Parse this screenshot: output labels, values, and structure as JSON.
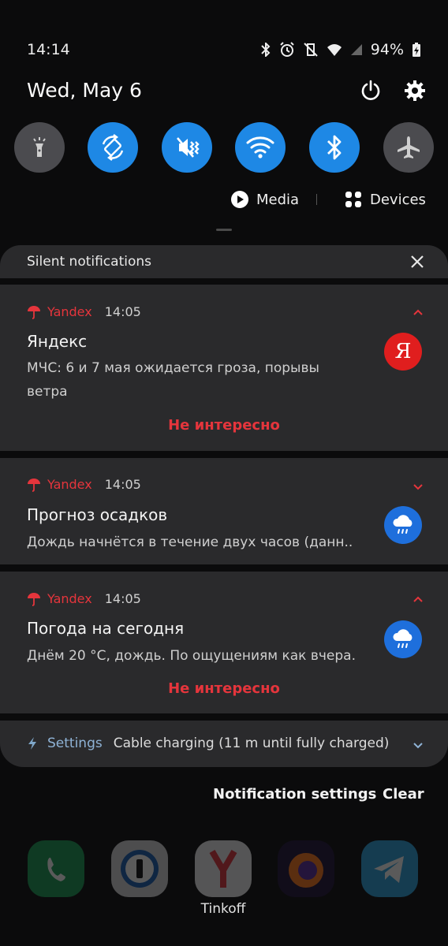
{
  "status_bar": {
    "time": "14:14",
    "battery": "94%"
  },
  "header": {
    "date": "Wed, May 6"
  },
  "media_row": {
    "media_label": "Media",
    "devices_label": "Devices"
  },
  "silent_section": {
    "title": "Silent notifications"
  },
  "notifications": [
    {
      "app": "Yandex",
      "time": "14:05",
      "title": "Яндекс",
      "body_line1": "МЧС: 6 и 7 мая ожидается гроза, порывы",
      "body_line2": "ветра",
      "action": "Не интересно"
    },
    {
      "app": "Yandex",
      "time": "14:05",
      "title": "Прогноз осадков",
      "body": "Дождь начнётся в течение двух часов (данн.."
    },
    {
      "app": "Yandex",
      "time": "14:05",
      "title": "Погода на сегодня",
      "body": "Днём 20 °C, дождь. По ощущениям как вчера.",
      "action": "Не интересно"
    }
  ],
  "system_notification": {
    "app": "Settings",
    "text": "Cable charging (11 m until fully charged)"
  },
  "footer": {
    "notification_settings": "Notification settings",
    "clear": "Clear"
  },
  "dock": {
    "label_yandex": "Tinkoff"
  },
  "colors": {
    "accent_blue": "#1e88e5",
    "yandex_red": "#e5353c",
    "card_bg": "#2a2a2c"
  },
  "icons": [
    "flashlight-icon",
    "auto-rotate-icon",
    "vibrate-icon",
    "wifi-icon",
    "bluetooth-icon",
    "airplane-icon",
    "power-icon",
    "gear-icon",
    "play-icon",
    "devices-icon",
    "close-icon",
    "umbrella-icon",
    "chevron-up-icon",
    "chevron-down-icon",
    "rain-icon",
    "bolt-icon"
  ]
}
